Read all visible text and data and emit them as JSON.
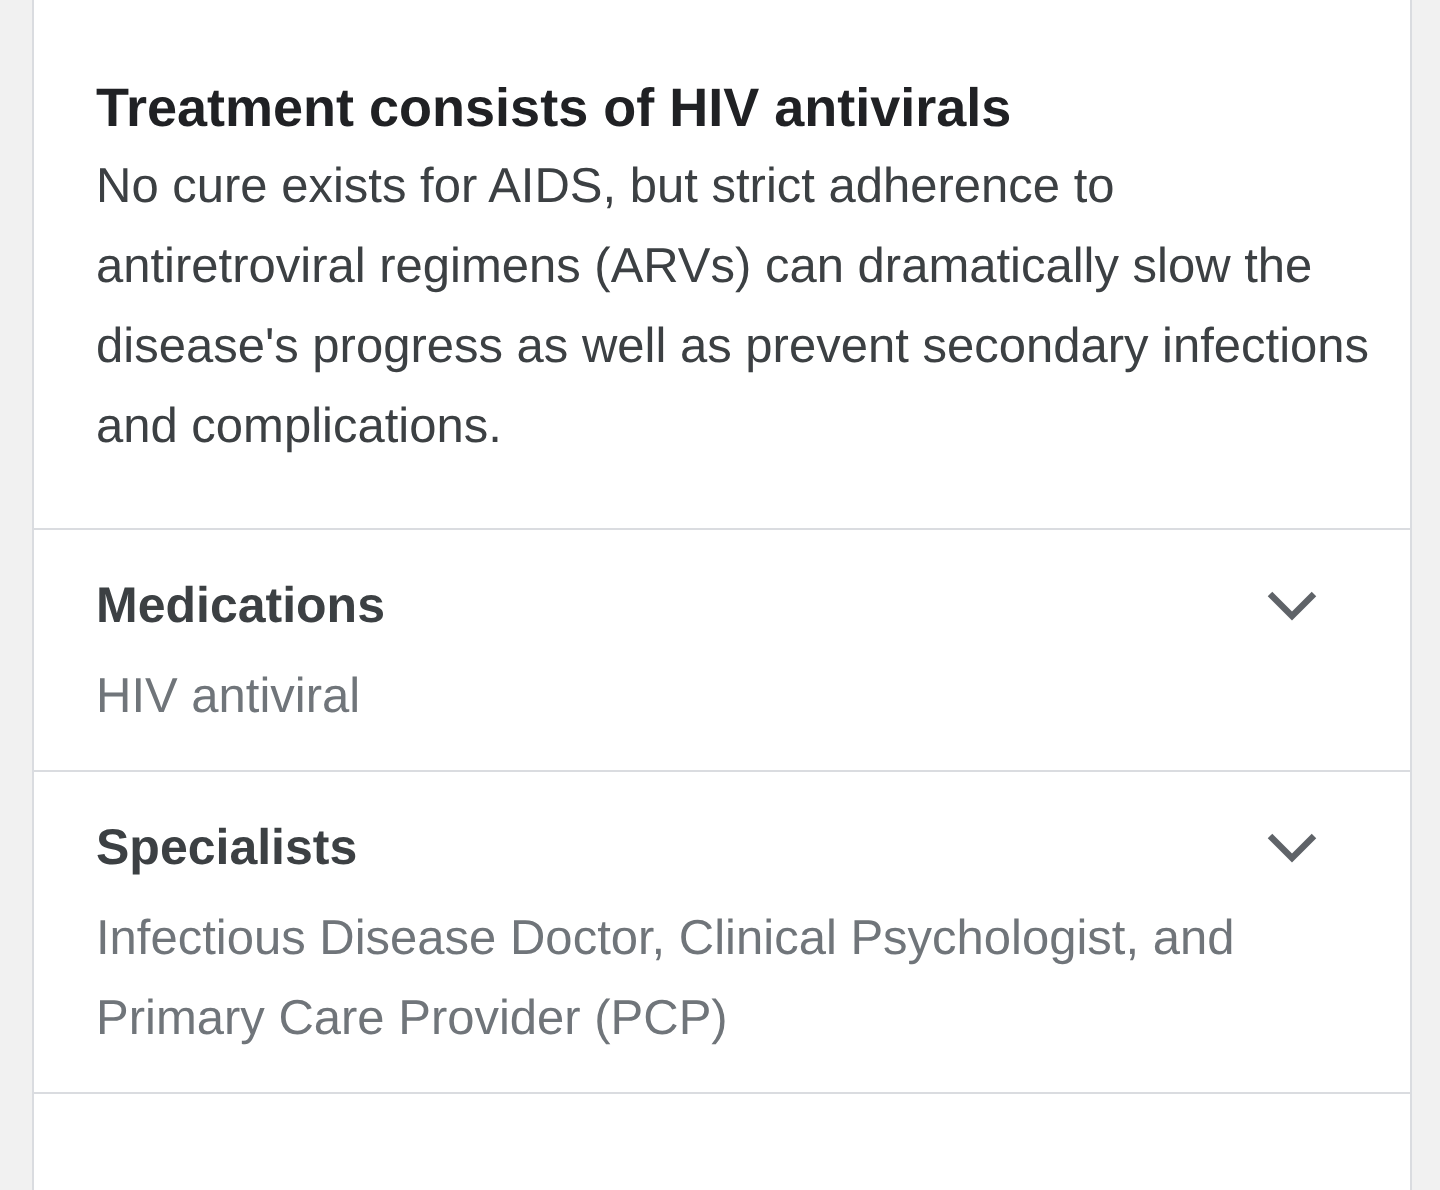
{
  "summary": {
    "title": "Treatment consists of HIV antivirals",
    "text": "No cure exists for AIDS, but strict adherence to antiretroviral regimens (ARVs) can dramatically slow the disease's progress as well as prevent secondary infections and complications."
  },
  "sections": [
    {
      "title": "Medications",
      "text": "HIV antiviral",
      "expanded": false
    },
    {
      "title": "Specialists",
      "text": "Infectious Disease Doctor, Clinical Psychologist, and Primary Care Provider (PCP)",
      "expanded": false
    }
  ]
}
